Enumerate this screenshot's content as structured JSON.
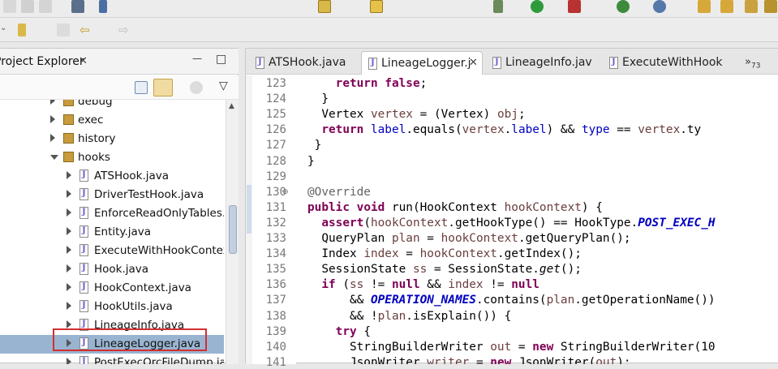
{
  "explorer": {
    "title": "Project Explorer",
    "close_glyph": "✕",
    "minimize_glyph": "—",
    "maximize_glyph": "□",
    "menu_glyph": "▽",
    "tree": [
      {
        "label": "debug",
        "type": "package",
        "indent": 0,
        "open": false
      },
      {
        "label": "exec",
        "type": "package",
        "indent": 0,
        "open": false
      },
      {
        "label": "history",
        "type": "package",
        "indent": 0,
        "open": false
      },
      {
        "label": "hooks",
        "type": "package",
        "indent": 0,
        "open": true
      },
      {
        "label": "ATSHook.java",
        "type": "java",
        "indent": 1,
        "open": false
      },
      {
        "label": "DriverTestHook.java",
        "type": "java",
        "indent": 1,
        "open": false
      },
      {
        "label": "EnforceReadOnlyTables.j",
        "type": "java",
        "indent": 1,
        "open": false
      },
      {
        "label": "Entity.java",
        "type": "java",
        "indent": 1,
        "open": false
      },
      {
        "label": "ExecuteWithHookContex",
        "type": "java",
        "indent": 1,
        "open": false
      },
      {
        "label": "Hook.java",
        "type": "java",
        "indent": 1,
        "open": false
      },
      {
        "label": "HookContext.java",
        "type": "java",
        "indent": 1,
        "open": false
      },
      {
        "label": "HookUtils.java",
        "type": "java",
        "indent": 1,
        "open": false
      },
      {
        "label": "LineageInfo.java",
        "type": "java",
        "indent": 1,
        "open": false
      },
      {
        "label": "LineageLogger.java",
        "type": "java",
        "indent": 1,
        "open": false,
        "selected": true
      },
      {
        "label": "PostExecOrcFileDump.jav",
        "type": "java",
        "indent": 1,
        "open": false
      }
    ]
  },
  "editor": {
    "tabs": [
      {
        "label": "ATSHook.java",
        "active": false
      },
      {
        "label": "LineageLogger.j",
        "active": true,
        "close": "✕"
      },
      {
        "label": "LineageInfo.jav",
        "active": false
      },
      {
        "label": "ExecuteWithHook",
        "active": false
      }
    ],
    "overflow": "»",
    "overflow_count": "73",
    "lines": [
      {
        "n": "123",
        "code": [
          [
            "    ",
            ""
          ],
          [
            "return",
            "kw"
          ],
          [
            " ",
            ""
          ],
          [
            "false",
            "kw"
          ],
          [
            ";",
            ""
          ]
        ]
      },
      {
        "n": "124",
        "code": [
          [
            "  }",
            ""
          ]
        ]
      },
      {
        "n": "125",
        "code": [
          [
            "  Vertex ",
            ""
          ],
          [
            "vertex",
            "var"
          ],
          [
            " = (Vertex) ",
            ""
          ],
          [
            "obj",
            "var"
          ],
          [
            ";",
            ""
          ]
        ]
      },
      {
        "n": "126",
        "code": [
          [
            "  ",
            ""
          ],
          [
            "return",
            "kw"
          ],
          [
            " ",
            ""
          ],
          [
            "label",
            "fld"
          ],
          [
            ".equals(",
            ""
          ],
          [
            "vertex",
            "var"
          ],
          [
            ".",
            ""
          ],
          [
            "label",
            "fld"
          ],
          [
            ") && ",
            ""
          ],
          [
            "type",
            "fld"
          ],
          [
            " == ",
            ""
          ],
          [
            "vertex",
            "var"
          ],
          [
            ".ty",
            ""
          ]
        ]
      },
      {
        "n": "127",
        "code": [
          [
            " }",
            ""
          ]
        ]
      },
      {
        "n": "128",
        "code": [
          [
            "}",
            ""
          ]
        ]
      },
      {
        "n": "129",
        "code": [
          [
            "",
            ""
          ]
        ]
      },
      {
        "n": "130",
        "fold": "⊖",
        "code": [
          [
            "@Override",
            "ann"
          ]
        ]
      },
      {
        "n": "131",
        "code": [
          [
            "",
            ""
          ],
          [
            "public",
            "kw"
          ],
          [
            " ",
            ""
          ],
          [
            "void",
            "kw"
          ],
          [
            " run(HookContext ",
            ""
          ],
          [
            "hookContext",
            "var"
          ],
          [
            ") {",
            ""
          ]
        ]
      },
      {
        "n": "132",
        "code": [
          [
            "  ",
            ""
          ],
          [
            "assert",
            "kw"
          ],
          [
            "(",
            ""
          ],
          [
            "hookContext",
            "var"
          ],
          [
            ".getHookType() == HookType.",
            ""
          ],
          [
            "POST_EXEC_H",
            "st"
          ]
        ]
      },
      {
        "n": "133",
        "code": [
          [
            "  QueryPlan ",
            ""
          ],
          [
            "plan",
            "var"
          ],
          [
            " = ",
            ""
          ],
          [
            "hookContext",
            "var"
          ],
          [
            ".getQueryPlan();",
            ""
          ]
        ]
      },
      {
        "n": "134",
        "code": [
          [
            "  Index ",
            ""
          ],
          [
            "index",
            "var"
          ],
          [
            " = ",
            ""
          ],
          [
            "hookContext",
            "var"
          ],
          [
            ".getIndex();",
            ""
          ]
        ]
      },
      {
        "n": "135",
        "code": [
          [
            "  SessionState ",
            ""
          ],
          [
            "ss",
            "var"
          ],
          [
            " = SessionState.",
            ""
          ],
          [
            "get",
            "ital"
          ],
          [
            "();",
            ""
          ]
        ]
      },
      {
        "n": "136",
        "code": [
          [
            "  ",
            ""
          ],
          [
            "if",
            "kw"
          ],
          [
            " (",
            ""
          ],
          [
            "ss",
            "var"
          ],
          [
            " != ",
            ""
          ],
          [
            "null",
            "kw"
          ],
          [
            " && ",
            ""
          ],
          [
            "index",
            "var"
          ],
          [
            " != ",
            ""
          ],
          [
            "null",
            "kw"
          ]
        ]
      },
      {
        "n": "137",
        "code": [
          [
            "      && ",
            ""
          ],
          [
            "OPERATION_NAMES",
            "st"
          ],
          [
            ".contains(",
            ""
          ],
          [
            "plan",
            "var"
          ],
          [
            ".getOperationName())",
            ""
          ]
        ]
      },
      {
        "n": "138",
        "code": [
          [
            "      && !",
            ""
          ],
          [
            "plan",
            "var"
          ],
          [
            ".isExplain()) {",
            ""
          ]
        ]
      },
      {
        "n": "139",
        "code": [
          [
            "    ",
            ""
          ],
          [
            "try",
            "kw"
          ],
          [
            " {",
            ""
          ]
        ]
      },
      {
        "n": "140",
        "code": [
          [
            "      StringBuilderWriter ",
            ""
          ],
          [
            "out",
            "var"
          ],
          [
            " = ",
            ""
          ],
          [
            "new",
            "kw"
          ],
          [
            " StringBuilderWriter(10",
            ""
          ]
        ]
      },
      {
        "n": "141",
        "code": [
          [
            "      JsonWriter ",
            ""
          ],
          [
            "writer",
            "var"
          ],
          [
            " = ",
            ""
          ],
          [
            "new",
            "kw"
          ],
          [
            " JsonWriter(",
            ""
          ],
          [
            "out",
            "var"
          ],
          [
            ");",
            ""
          ]
        ]
      }
    ]
  }
}
